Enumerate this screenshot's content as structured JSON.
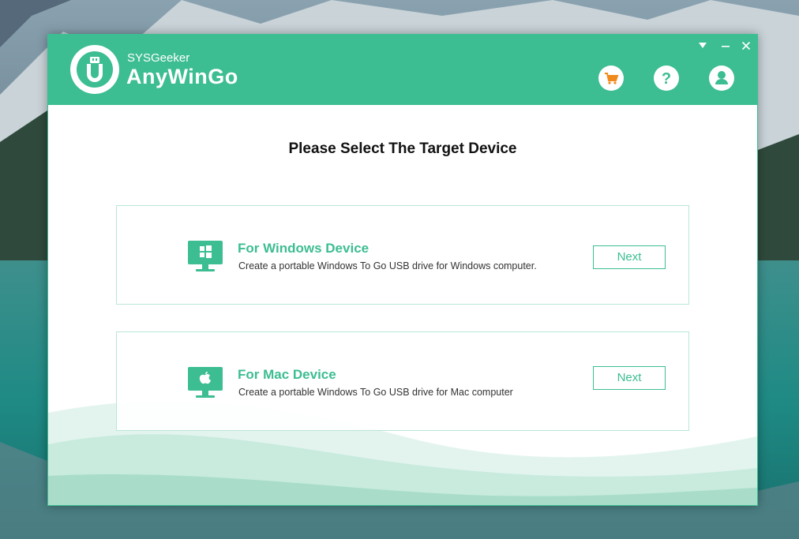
{
  "app": {
    "vendor": "SYSGeeker",
    "name": "AnyWinGo"
  },
  "window_controls": {
    "dropdown_icon": "triangle-down",
    "minimize_icon": "minus",
    "close_icon": "x"
  },
  "header_icons": [
    "cart-icon",
    "help-icon",
    "user-icon"
  ],
  "colors": {
    "accent": "#3cbd92",
    "white": "#ffffff",
    "cart_orange": "#f08a1c"
  },
  "main": {
    "title": "Please Select The Target Device",
    "options": [
      {
        "title": "For Windows Device",
        "description": "Create a portable Windows To Go USB drive for Windows computer.",
        "button": "Next",
        "icon": "windows-monitor-icon"
      },
      {
        "title": "For Mac Device",
        "description": "Create a portable Windows To Go USB drive for Mac computer",
        "button": "Next",
        "icon": "mac-monitor-icon"
      }
    ]
  }
}
